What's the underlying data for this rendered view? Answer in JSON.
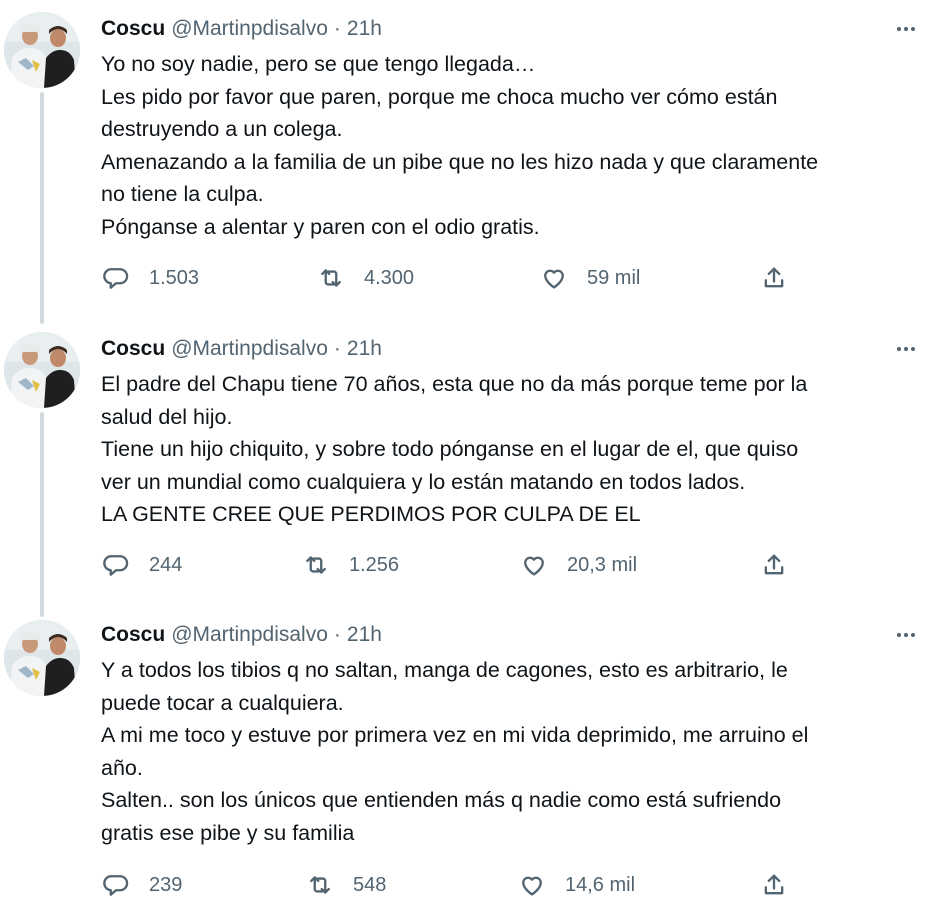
{
  "tweets": [
    {
      "name": "Coscu",
      "handle": "@Martinpdisalvo",
      "separator": "·",
      "time": "21h",
      "lines": [
        "Yo no soy nadie, pero se que tengo llegada…",
        "Les pido por favor que paren, porque me choca mucho ver cómo están",
        "destruyendo a un colega.",
        "Amenazando a la familia de un pibe que no les hizo nada y que claramente",
        "no tiene la culpa.",
        "Pónganse a alentar y paren con el odio gratis."
      ],
      "replies": "1.503",
      "retweets": "4.300",
      "likes": "59 mil"
    },
    {
      "name": "Coscu",
      "handle": "@Martinpdisalvo",
      "separator": "·",
      "time": "21h",
      "lines": [
        "El padre del Chapu tiene 70 años, esta que no da más porque teme por la",
        "salud del hijo.",
        "Tiene un hijo chiquito, y sobre todo pónganse en el lugar de el, que quiso",
        "ver un mundial como cualquiera y lo están matando en todos lados.",
        "LA GENTE CREE QUE PERDIMOS POR CULPA DE EL"
      ],
      "replies": "244",
      "retweets": "1.256",
      "likes": "20,3 mil"
    },
    {
      "name": "Coscu",
      "handle": "@Martinpdisalvo",
      "separator": "·",
      "time": "21h",
      "lines": [
        "Y a todos los tibios q no saltan, manga de cagones, esto es arbitrario, le",
        "puede tocar a cualquiera.",
        "A mi me toco y estuve por primera vez en mi vida deprimido, me arruino el",
        "año.",
        "Salten.. son los únicos que entienden más q nadie como está sufriendo",
        "gratis ese pibe y su familia"
      ],
      "replies": "239",
      "retweets": "548",
      "likes": "14,6 mil"
    }
  ],
  "icons": {
    "reply": "reply-icon",
    "retweet": "retweet-icon",
    "like": "heart-icon",
    "share": "share-icon",
    "more": "more-options-icon"
  },
  "colors": {
    "text": "#0f1419",
    "secondary": "#536471",
    "thread_line": "#cfd9de",
    "background": "#ffffff"
  }
}
